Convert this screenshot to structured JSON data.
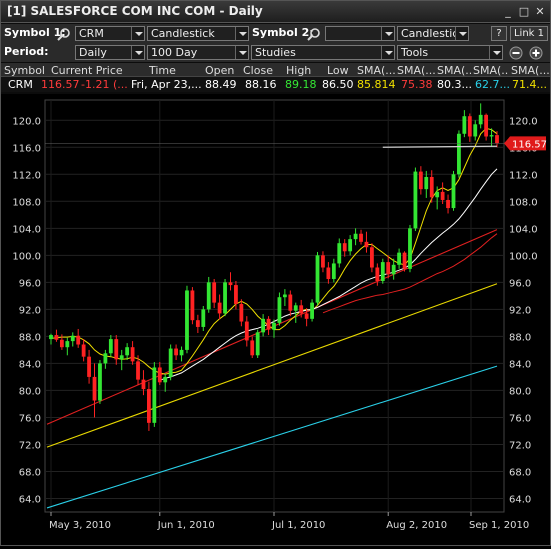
{
  "window": {
    "title": "[1] SALESFORCE COM INC COM - Daily",
    "min_glyph": "_",
    "max_glyph": "□",
    "close_glyph": "✕"
  },
  "toolbar1": {
    "symbol1_label": "Symbol 1:",
    "symbol1_value": "CRM",
    "chart_type": "Candlestick",
    "symbol2_label": "Symbol 2:",
    "symbol2_value": "",
    "chart_type2": "Candlestick",
    "help_label": "?",
    "link_label": "Link 1"
  },
  "toolbar2": {
    "period_label": "Period:",
    "period_value": "Daily",
    "range_value": "100 Day",
    "studies_value": "Studies",
    "tools_value": "Tools"
  },
  "quote_table": {
    "headers": [
      "Symbol",
      "Current Price",
      "Time",
      "Open",
      "Close",
      "High",
      "Low",
      "SMA(...",
      "SMA(...",
      "SMA(...",
      "SMA(...",
      "SMA(..."
    ],
    "row": {
      "symbol": "CRM",
      "price": "116.57",
      "change": "-1.21 (...",
      "time": "Fri, Apr 23,...",
      "open": "88.49",
      "close": "88.16",
      "high": "89.18",
      "low": "86.50",
      "sma1": "85.814",
      "sma2": "75.38",
      "sma3": "80.3...",
      "sma4": "62.7...",
      "sma5": "71.4..."
    },
    "colors": {
      "price": "#ff3b3b",
      "change": "#ff3b3b",
      "high": "#35e835",
      "sma1": "#f0e000",
      "sma2": "#ff3b3b",
      "sma4": "#2ad0e8",
      "sma5": "#f0e000"
    }
  },
  "chart_data": {
    "type": "candlestick",
    "symbol": "CRM",
    "period": "Daily",
    "ylim": [
      62,
      123
    ],
    "y_ticks": [
      "64.0",
      "68.0",
      "72.0",
      "76.0",
      "80.0",
      "84.0",
      "88.0",
      "92.0",
      "96.0",
      "100.0",
      "104.0",
      "108.0",
      "112.0",
      "116.0",
      "120.0"
    ],
    "x_ticks": [
      "May 3, 2010",
      "Jun 1, 2010",
      "Jul 1, 2010",
      "Aug 2, 2010",
      "Sep 1, 2010"
    ],
    "last_price_label": "116.57",
    "candles": [
      [
        87.6,
        88.4,
        86.8,
        88.2
      ],
      [
        88.2,
        89.0,
        87.2,
        87.5
      ],
      [
        87.5,
        88.3,
        86.0,
        86.4
      ],
      [
        86.4,
        87.8,
        85.2,
        87.3
      ],
      [
        87.3,
        88.6,
        86.5,
        88.1
      ],
      [
        88.1,
        89.1,
        86.3,
        86.8
      ],
      [
        86.8,
        87.6,
        84.3,
        85.0
      ],
      [
        85.0,
        86.0,
        81.0,
        82.0
      ],
      [
        82.0,
        84.0,
        76.0,
        78.5
      ],
      [
        78.5,
        84.5,
        78.0,
        84.0
      ],
      [
        84.0,
        86.0,
        83.2,
        85.5
      ],
      [
        85.5,
        88.2,
        85.0,
        87.6
      ],
      [
        87.6,
        88.2,
        83.8,
        84.6
      ],
      [
        84.6,
        86.0,
        83.0,
        85.2
      ],
      [
        85.2,
        87.0,
        84.5,
        86.4
      ],
      [
        86.4,
        87.3,
        83.8,
        84.3
      ],
      [
        84.3,
        85.2,
        80.8,
        81.6
      ],
      [
        81.6,
        83.0,
        79.3,
        80.2
      ],
      [
        80.2,
        81.3,
        74.0,
        75.2
      ],
      [
        75.2,
        84.2,
        74.6,
        83.4
      ],
      [
        83.4,
        84.2,
        80.8,
        81.2
      ],
      [
        81.2,
        82.5,
        79.8,
        82.0
      ],
      [
        82.0,
        86.8,
        81.5,
        86.2
      ],
      [
        86.2,
        86.8,
        84.5,
        85.2
      ],
      [
        85.2,
        86.5,
        84.3,
        86.0
      ],
      [
        86.0,
        95.5,
        85.5,
        94.8
      ],
      [
        94.8,
        95.3,
        89.8,
        90.4
      ],
      [
        90.4,
        91.2,
        88.5,
        89.4
      ],
      [
        89.4,
        92.5,
        88.8,
        92.0
      ],
      [
        92.0,
        96.8,
        91.5,
        96.0
      ],
      [
        96.0,
        96.5,
        92.2,
        93.0
      ],
      [
        93.0,
        94.2,
        90.5,
        91.4
      ],
      [
        91.4,
        96.5,
        91.0,
        96.0
      ],
      [
        96.0,
        97.5,
        94.8,
        95.6
      ],
      [
        95.6,
        96.2,
        92.0,
        92.8
      ],
      [
        92.8,
        93.5,
        89.5,
        90.2
      ],
      [
        90.2,
        91.0,
        86.5,
        87.4
      ],
      [
        87.4,
        88.0,
        84.8,
        85.2
      ],
      [
        85.2,
        89.0,
        84.8,
        88.6
      ],
      [
        88.6,
        91.3,
        88.0,
        90.6
      ],
      [
        90.6,
        91.0,
        88.2,
        89.0
      ],
      [
        89.0,
        90.5,
        87.8,
        90.0
      ],
      [
        90.0,
        94.5,
        89.6,
        93.8
      ],
      [
        93.8,
        95.0,
        92.5,
        94.2
      ],
      [
        94.2,
        94.8,
        91.0,
        91.8
      ],
      [
        91.8,
        93.0,
        90.0,
        92.6
      ],
      [
        92.6,
        93.4,
        90.8,
        91.4
      ],
      [
        91.4,
        92.2,
        89.5,
        90.6
      ],
      [
        90.6,
        93.5,
        90.2,
        93.0
      ],
      [
        93.0,
        100.5,
        92.6,
        100.0
      ],
      [
        100.0,
        100.6,
        97.5,
        98.2
      ],
      [
        98.2,
        99.0,
        95.8,
        96.5
      ],
      [
        96.5,
        99.5,
        96.0,
        98.8
      ],
      [
        98.8,
        102.5,
        98.2,
        101.8
      ],
      [
        101.8,
        102.4,
        99.8,
        100.6
      ],
      [
        100.6,
        103.0,
        100.0,
        102.4
      ],
      [
        102.4,
        104.0,
        101.5,
        103.2
      ],
      [
        103.2,
        103.8,
        101.6,
        102.0
      ],
      [
        102.0,
        103.5,
        100.4,
        101.2
      ],
      [
        101.2,
        101.8,
        97.5,
        98.2
      ],
      [
        98.2,
        98.8,
        95.5,
        96.2
      ],
      [
        96.2,
        99.5,
        95.8,
        99.0
      ],
      [
        99.0,
        100.0,
        96.6,
        97.2
      ],
      [
        97.2,
        99.5,
        96.4,
        98.6
      ],
      [
        98.6,
        101.0,
        98.0,
        100.4
      ],
      [
        100.4,
        100.6,
        97.6,
        98.0
      ],
      [
        98.0,
        104.5,
        97.5,
        104.0
      ],
      [
        104.0,
        113.0,
        103.6,
        112.4
      ],
      [
        112.4,
        113.2,
        109.0,
        109.8
      ],
      [
        109.8,
        112.5,
        108.5,
        111.6
      ],
      [
        111.6,
        112.6,
        107.8,
        108.6
      ],
      [
        108.6,
        110.2,
        106.8,
        109.4
      ],
      [
        109.4,
        110.8,
        107.6,
        108.2
      ],
      [
        108.2,
        109.0,
        106.2,
        107.0
      ],
      [
        107.0,
        112.5,
        106.6,
        112.0
      ],
      [
        112.0,
        118.5,
        111.5,
        118.0
      ],
      [
        118.0,
        121.5,
        117.5,
        120.6
      ],
      [
        120.6,
        121.0,
        116.8,
        117.6
      ],
      [
        117.6,
        120.0,
        117.0,
        119.4
      ],
      [
        119.4,
        122.5,
        118.8,
        120.8
      ],
      [
        120.8,
        121.0,
        117.0,
        117.6
      ],
      [
        117.6,
        118.8,
        116.2,
        117.8
      ],
      [
        117.8,
        118.4,
        116.0,
        116.6
      ]
    ],
    "sma_lines": [
      {
        "color": "#f0e000",
        "values": [
          87.7,
          87.8,
          87.9,
          87.9,
          88.0,
          87.9,
          87.5,
          86.9,
          86.0,
          85.4,
          85.1,
          85.0,
          84.8,
          84.6,
          84.7,
          84.9,
          84.7,
          84.2,
          83.5,
          82.9,
          82.6,
          82.4,
          82.6,
          82.7,
          83.0,
          84.0,
          85.1,
          86.3,
          87.5,
          88.8,
          89.9,
          90.6,
          91.2,
          92.0,
          92.8,
          93.2,
          92.8,
          92.0,
          91.0,
          90.3,
          89.6,
          89.0,
          89.0,
          89.6,
          90.4,
          91.1,
          91.8,
          92.0,
          91.8,
          92.6,
          93.6,
          94.6,
          95.4,
          96.6,
          98.0,
          99.2,
          100.2,
          101.0,
          101.6,
          101.6,
          101.0,
          100.4,
          99.8,
          99.2,
          98.8,
          98.6,
          99.5,
          101.8,
          104.2,
          106.6,
          108.4,
          109.6,
          110.0,
          109.6,
          110.0,
          111.2,
          113.0,
          114.8,
          116.2,
          118.0,
          118.8,
          118.6,
          118.0
        ]
      },
      {
        "color": "#ffffff",
        "values": [
          null,
          null,
          null,
          null,
          null,
          null,
          null,
          null,
          null,
          null,
          null,
          null,
          null,
          null,
          null,
          null,
          null,
          null,
          null,
          null,
          81.5,
          81.8,
          82.0,
          82.3,
          82.6,
          83.1,
          83.6,
          84.1,
          84.6,
          85.2,
          85.8,
          86.4,
          87.0,
          87.6,
          88.1,
          88.5,
          88.8,
          89.0,
          89.2,
          89.5,
          89.8,
          90.2,
          90.6,
          91.0,
          91.3,
          91.5,
          91.7,
          91.9,
          92.0,
          92.3,
          92.7,
          93.1,
          93.5,
          93.9,
          94.4,
          94.9,
          95.4,
          95.9,
          96.3,
          96.6,
          96.9,
          97.1,
          97.3,
          97.5,
          97.8,
          98.1,
          98.6,
          99.4,
          100.3,
          101.1,
          101.9,
          102.6,
          103.3,
          103.9,
          104.6,
          105.4,
          106.4,
          107.5,
          108.6,
          109.8,
          110.9,
          112.0,
          112.8
        ]
      },
      {
        "color": "#e02020",
        "values": [
          null,
          null,
          null,
          null,
          null,
          null,
          null,
          null,
          null,
          null,
          null,
          null,
          null,
          null,
          null,
          null,
          null,
          null,
          null,
          null,
          null,
          null,
          null,
          null,
          null,
          null,
          null,
          null,
          null,
          null,
          null,
          null,
          null,
          null,
          null,
          null,
          null,
          null,
          null,
          null,
          null,
          null,
          null,
          null,
          null,
          null,
          null,
          null,
          null,
          null,
          91.5,
          91.8,
          92.1,
          92.4,
          92.7,
          93.0,
          93.3,
          93.5,
          93.7,
          93.9,
          94.1,
          94.2,
          94.4,
          94.6,
          94.8,
          95.0,
          95.3,
          95.7,
          96.1,
          96.5,
          96.9,
          97.3,
          97.6,
          98.0,
          98.4,
          98.9,
          99.4,
          100.0,
          100.6,
          101.2,
          101.9,
          102.6,
          103.2
        ]
      },
      {
        "color": "#e8d800",
        "values": [
          null,
          null,
          null,
          null,
          null,
          null,
          null,
          null,
          null,
          null,
          null,
          null,
          null,
          null,
          null,
          null,
          null,
          null,
          null,
          null,
          null,
          null,
          null,
          null,
          null,
          null,
          null,
          null,
          null,
          null,
          null,
          null,
          null,
          null,
          null,
          null,
          null,
          null,
          null,
          null,
          null,
          null,
          null,
          null,
          null,
          null,
          null,
          null,
          null,
          null,
          null,
          null,
          null,
          null,
          null,
          null,
          null,
          null,
          null,
          null,
          null,
          null,
          null,
          null,
          null,
          null,
          null,
          null,
          null,
          null,
          null,
          null,
          null,
          null,
          null,
          null,
          null,
          null,
          null,
          null,
          null,
          null,
          null
        ]
      },
      {
        "color": "#2ad0e8",
        "values": []
      }
    ],
    "long_sma_endpoints": [
      {
        "color": "#e02020",
        "start": 75.0,
        "end": 103.8
      },
      {
        "color": "#e8d800",
        "start": 71.6,
        "end": 95.8
      },
      {
        "color": "#2ad0e8",
        "start": 62.6,
        "end": 83.6
      }
    ],
    "trendline": {
      "color": "#cfcfcf",
      "start_index": 61,
      "end_index": 82,
      "y": 116.0
    }
  }
}
